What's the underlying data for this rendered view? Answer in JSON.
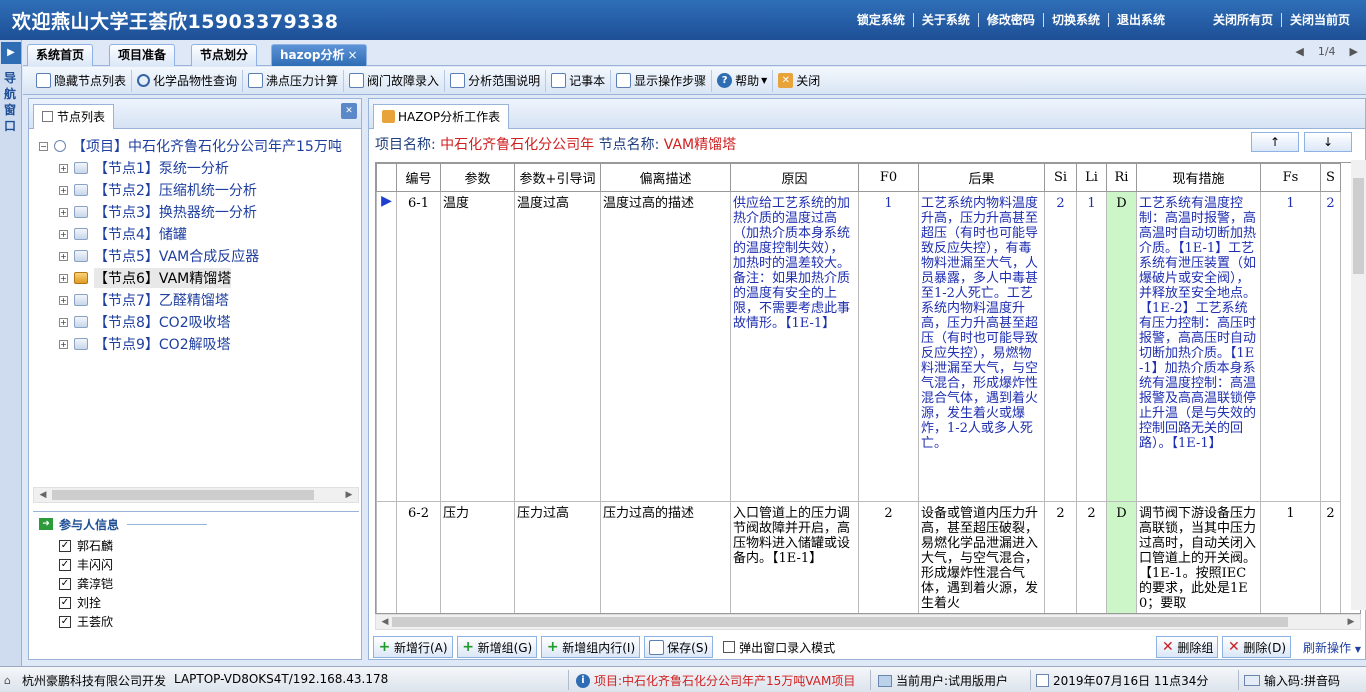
{
  "header": {
    "title": "欢迎燕山大学王荟欣15903379338",
    "links": [
      "锁定系统",
      "关于系统",
      "修改密码",
      "切换系统",
      "退出系统"
    ],
    "links_right": [
      "关闭所有页",
      "关闭当前页"
    ]
  },
  "navstrip": {
    "label": "导航窗口"
  },
  "tabs": [
    {
      "label": "系统首页"
    },
    {
      "label": "项目准备"
    },
    {
      "label": "节点划分"
    },
    {
      "label": "hazop分析",
      "close": "×"
    }
  ],
  "pager": {
    "prev": "◀",
    "page": "1/4",
    "next": "▶"
  },
  "toolbar": [
    {
      "label": "隐藏节点列表",
      "icon": "list-icon"
    },
    {
      "label": "化学品物性查询",
      "icon": "search-icon"
    },
    {
      "label": "沸点压力计算",
      "icon": "document-icon"
    },
    {
      "label": "阀门故障录入",
      "icon": "valve-icon"
    },
    {
      "label": "分析范围说明",
      "icon": "document-icon"
    },
    {
      "label": "记事本",
      "icon": "notepad-icon"
    },
    {
      "label": "显示操作步骤",
      "icon": "steps-icon"
    },
    {
      "label": "帮助",
      "icon": "help-icon"
    },
    {
      "label": "关闭",
      "icon": "close-icon"
    }
  ],
  "left_panel": {
    "tab": "节点列表",
    "project": "【项目】中石化齐鲁石化分公司年产15万吨",
    "nodes": [
      "【节点1】泵统一分析",
      "【节点2】压缩机统一分析",
      "【节点3】换热器统一分析",
      "【节点4】储罐",
      "【节点5】VAM合成反应器",
      "【节点6】VAM精馏塔",
      "【节点7】乙醛精馏塔",
      "【节点8】CO2吸收塔",
      "【节点9】CO2解吸塔"
    ],
    "participants_title": "参与人信息",
    "participants": [
      "郭石麟",
      "丰闪闪",
      "龚淳铠",
      "刘拴",
      "王荟欣"
    ]
  },
  "right_panel": {
    "tab": "HAZOP分析工作表",
    "project_label": "项目名称:",
    "project_value": "中石化齐鲁石化分公司年",
    "node_label": "节点名称:",
    "node_value": "VAM精馏塔",
    "up": "↑",
    "down": "↓",
    "columns": [
      "编号",
      "参数",
      "参数+引导词",
      "偏离描述",
      "原因",
      "F0",
      "后果",
      "Si",
      "Li",
      "Ri",
      "现有措施",
      "Fs",
      "S"
    ],
    "rows": [
      {
        "indicator": "▶",
        "id": "6-1",
        "param": "温度",
        "guide": "温度过高",
        "desc": "温度过高的描述",
        "cause": "供应给工艺系统的加热介质的温度过高（加热介质本身系统的温度控制失效），加热时的温差较大。备注：如果加热介质的温度有安全的上限，不需要考虑此事故情形。【1E-1】",
        "f0": "1",
        "consequence": "工艺系统内物料温度升高，压力升高甚至超压（有时也可能导致反应失控），有毒物料泄漏至大气，人员暴露，多人中毒甚至1-2人死亡。工艺系统内物料温度升高，压力升高甚至超压（有时也可能导致反应失控），易燃物料泄漏至大气，与空气混合，形成爆炸性混合气体，遇到着火源，发生着火或爆炸，1-2人或多人死亡。",
        "si": "2",
        "li": "1",
        "ri": "D",
        "measures": "工艺系统有温度控制：高温时报警，高高温时自动切断加热介质。【1E-1】工艺系统有泄压装置（如爆破片或安全阀），并释放至安全地点。【1E-2】工艺系统有压力控制：高压时报警，高高压时自动切断加热介质。【1E-1】加热介质本身系统有温度控制：高温报警及高高温联锁停止升温（是与失效的控制回路无关的回路）。【1E-1】",
        "fs": "1",
        "s": "2"
      },
      {
        "indicator": "",
        "id": "6-2",
        "param": "压力",
        "guide": "压力过高",
        "desc": "压力过高的描述",
        "cause": "入口管道上的压力调节阀故障并开启，高压物料进入储罐或设备内。【1E-1】",
        "f0": "2",
        "consequence": "设备或管道内压力升高，甚至超压破裂，易燃化学品泄漏进入大气，与空气混合，形成爆炸性混合气体，遇到着火源，发生着火",
        "si": "2",
        "li": "2",
        "ri": "D",
        "measures": "调节阀下游设备压力高联锁，当其中压力过高时，自动关闭入口管道上的开关阀。【1E-1。按照IEC的要求，此处是1E0；要取",
        "fs": "1",
        "s": "2"
      }
    ],
    "buttons": {
      "new_row": "新增行(A)",
      "new_group": "新增组(G)",
      "new_group_row": "新增组内行(I)",
      "save": "保存(S)",
      "popup": "弹出窗口录入模式",
      "del_group": "删除组",
      "del": "删除(D)",
      "refresh": "刷新操作"
    }
  },
  "statusbar": {
    "dev": "杭州豪鹏科技有限公司开发",
    "host": "LAPTOP-VD8OKS4T/192.168.43.178",
    "project": "项目:中石化齐鲁石化分公司年产15万吨VAM项目",
    "user": "当前用户:试用版用户",
    "date": "2019年07月16日 11点34分",
    "ime": "输入码:拼音码"
  }
}
